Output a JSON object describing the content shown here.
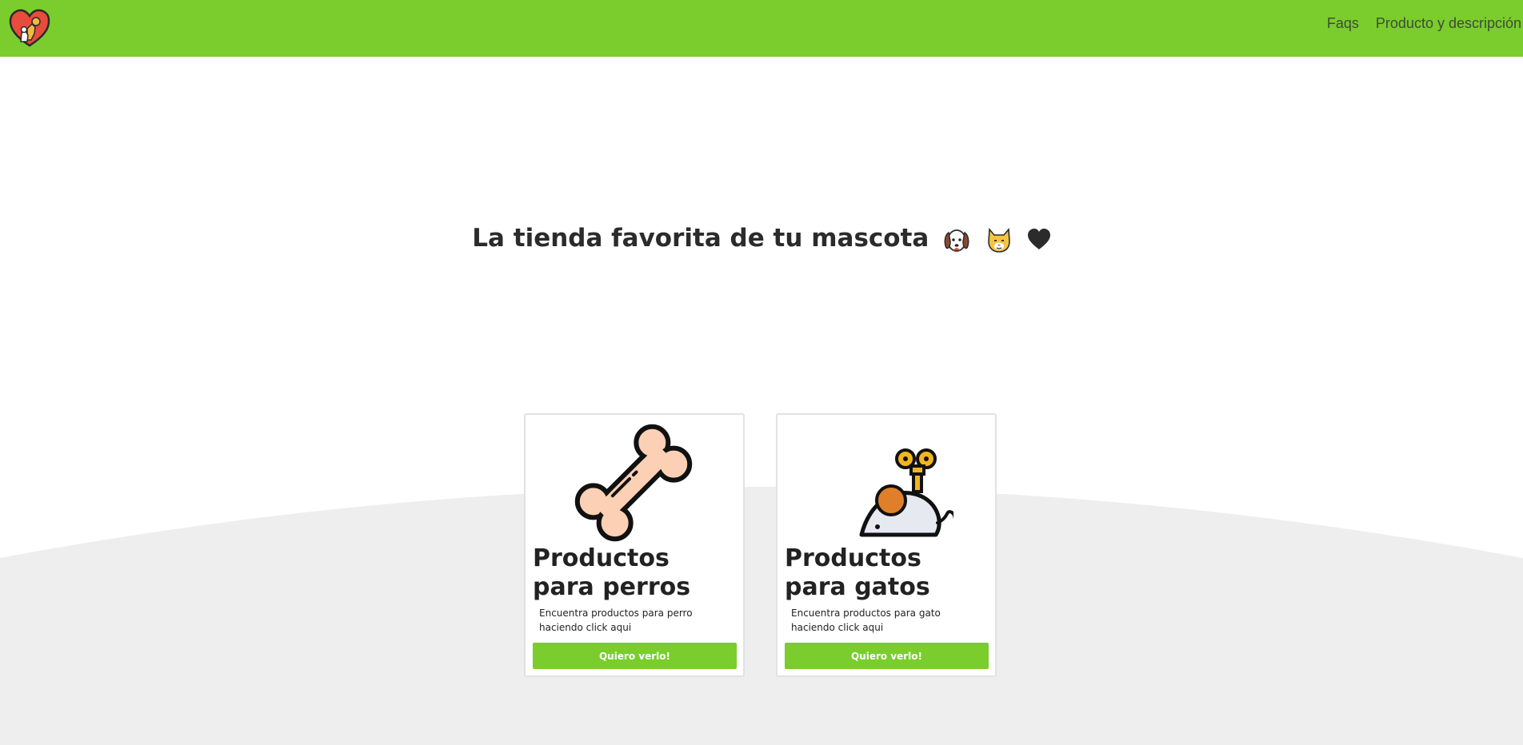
{
  "navbar": {
    "logo_icon": "pet-heart-logo-icon",
    "links": [
      "Faqs",
      "Producto y descripción"
    ]
  },
  "hero": {
    "title": "La tienda favorita de tu mascota",
    "emoji_icons": [
      "dog-face-icon",
      "cat-face-icon",
      "black-heart-icon"
    ]
  },
  "cards": [
    {
      "icon": "bone-icon",
      "title": "Productos para perros",
      "text": "Encuentra productos para perro haciendo click aqui",
      "button": "Quiero verlo!"
    },
    {
      "icon": "toy-mouse-icon",
      "title": "Productos para gatos",
      "text": "Encuentra productos para gato haciendo click aqui",
      "button": "Quiero verlo!"
    }
  ],
  "colors": {
    "brand_green": "#7acd2d",
    "wave_gray": "#eeeeee",
    "text_dark": "#212529"
  }
}
